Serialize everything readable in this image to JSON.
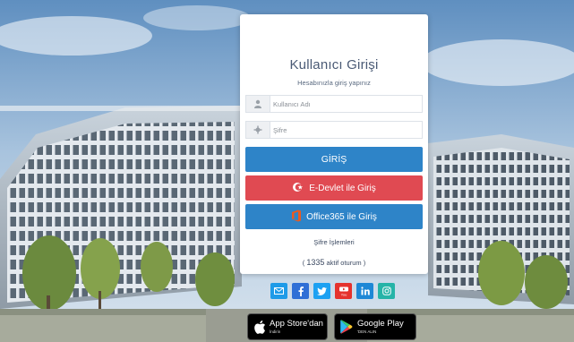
{
  "login": {
    "title": "Kullanıcı Girişi",
    "subtitle": "Hesabınızla giriş yapınız",
    "username_placeholder": "Kullanıcı Adı",
    "password_placeholder": "Şifre",
    "submit_label": "GİRİŞ",
    "edevlet_label": "E-Devlet ile Giriş",
    "office365_label": "Office365 ile Giriş",
    "password_ops_label": "Şifre İşlemleri",
    "sessions_count": "1335",
    "sessions_suffix": "aktif oturum",
    "sessions_open": "(",
    "sessions_close": ")"
  },
  "social": [
    {
      "name": "mail-icon",
      "color": "#1e9be8"
    },
    {
      "name": "facebook-icon",
      "color": "#2f6fd6"
    },
    {
      "name": "twitter-icon",
      "color": "#1da1f2"
    },
    {
      "name": "youtube-icon",
      "color": "#e5322d"
    },
    {
      "name": "linkedin-icon",
      "color": "#1e88d6"
    },
    {
      "name": "instagram-icon",
      "color": "#26b4a8"
    }
  ],
  "stores": {
    "apple_main": "App Store'dan",
    "apple_sub": "İndirin",
    "google_main": "Google Play",
    "google_sub": "'DEN ALIN"
  },
  "colors": {
    "primary": "#2e84c8",
    "edevlet": "#e04a52",
    "title_text": "#4a5a75"
  }
}
